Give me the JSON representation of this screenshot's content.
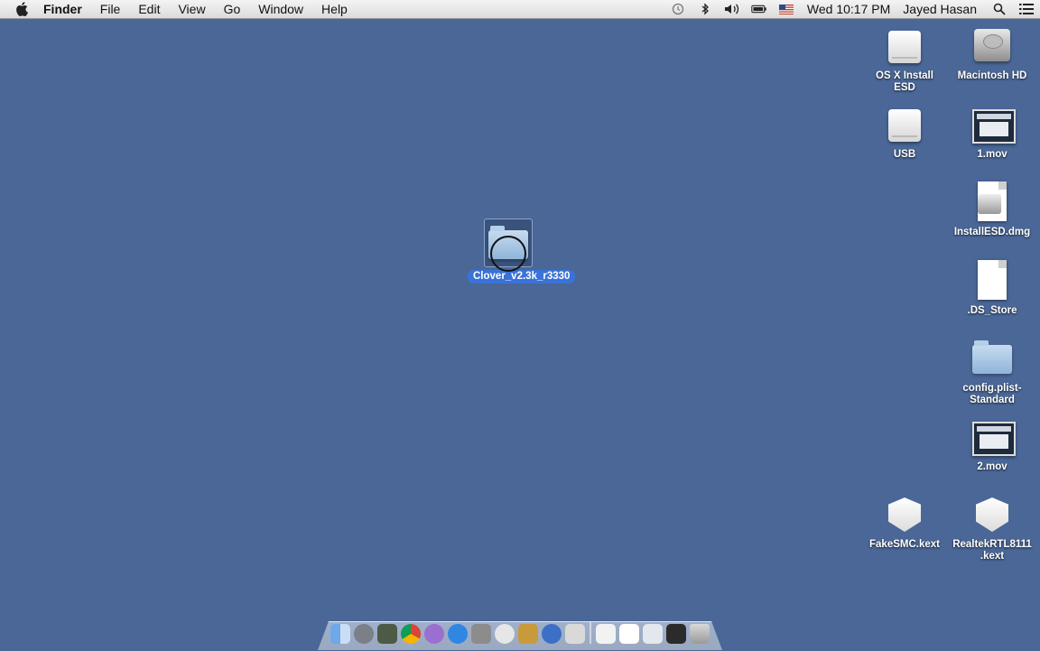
{
  "menubar": {
    "app_name": "Finder",
    "menus": [
      "File",
      "Edit",
      "View",
      "Go",
      "Window",
      "Help"
    ],
    "clock": "Wed 10:17 PM",
    "user": "Jayed Hasan",
    "status_icons": [
      "time-machine-icon",
      "bluetooth-icon",
      "volume-icon",
      "battery-icon",
      "us-flag-input-icon",
      "spotlight-search-icon",
      "notification-center-icon"
    ]
  },
  "desktop": {
    "dragged_item": {
      "label": "Clover_v2.3k_r3330"
    },
    "icons": [
      {
        "label": "OS X Install ESD",
        "kind": "drive"
      },
      {
        "label": "Macintosh HD",
        "kind": "hard-drive"
      },
      {
        "label": "USB",
        "kind": "drive"
      },
      {
        "label": "1.mov",
        "kind": "movie"
      },
      {
        "label": "InstallESD.dmg",
        "kind": "disk-image"
      },
      {
        "label": ".DS_Store",
        "kind": "document"
      },
      {
        "label": "config.plist-Standard",
        "kind": "folder"
      },
      {
        "label": "2.mov",
        "kind": "movie"
      },
      {
        "label": "FakeSMC.kext",
        "kind": "kext"
      },
      {
        "label": "RealtekRTL8111.kext",
        "kind": "kext"
      }
    ]
  },
  "dock": {
    "items": [
      "finder-icon",
      "launchpad-icon",
      "mission-control-icon",
      "chrome-icon",
      "itunes-icon",
      "app-store-icon",
      "system-preferences-icon",
      "textedit-icon",
      "terminal-icon",
      "safari-icon",
      "script-editor-icon",
      "applications-folder-icon",
      "documents-stack-icon",
      "downloads-stack-icon",
      "screen-stack-icon",
      "trash-icon"
    ]
  }
}
